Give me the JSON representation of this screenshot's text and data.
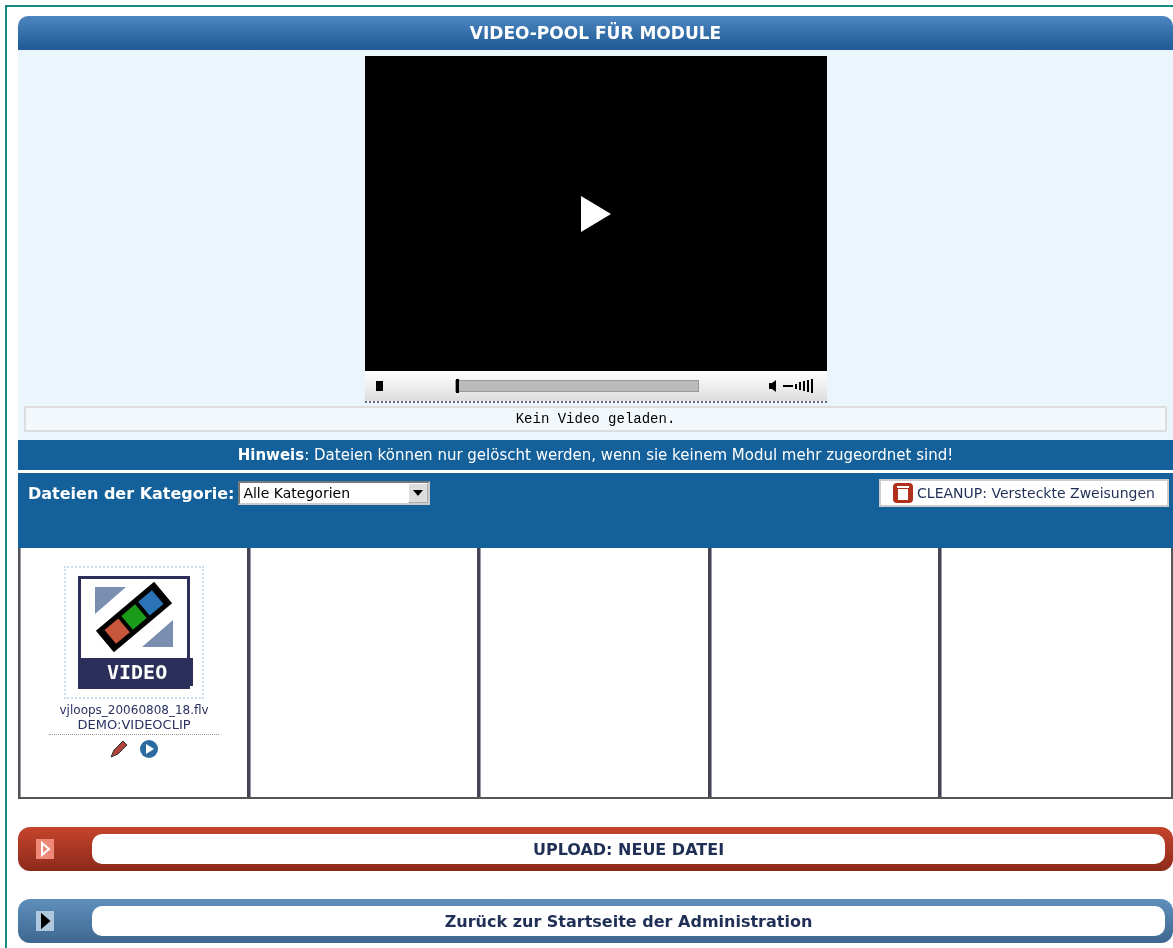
{
  "title": "VIDEO-POOL FÜR MODULE",
  "player": {
    "level": 0,
    "status": "Kein Video geladen."
  },
  "notice": {
    "label": "Hinweis",
    "text": ": Dateien können nur gelöscht werden, wenn sie keinem Modul mehr zugeordnet sind!"
  },
  "category": {
    "label": "Dateien der Kategorie:",
    "value": "Alle Kategorien"
  },
  "cleanup_button": "CLEANUP: Versteckte Zweisungen",
  "files": [
    {
      "kind": "video",
      "filename": "vjloops_20060808_18.flv",
      "category": "DEMO:VIDEOCLIP",
      "thumb_label": "VIDEO"
    }
  ],
  "bars": [
    {
      "kind": "upload",
      "label": "UPLOAD: NEUE DATEI"
    },
    {
      "kind": "back",
      "label": "Zurück zur Startseite der Administration"
    }
  ]
}
